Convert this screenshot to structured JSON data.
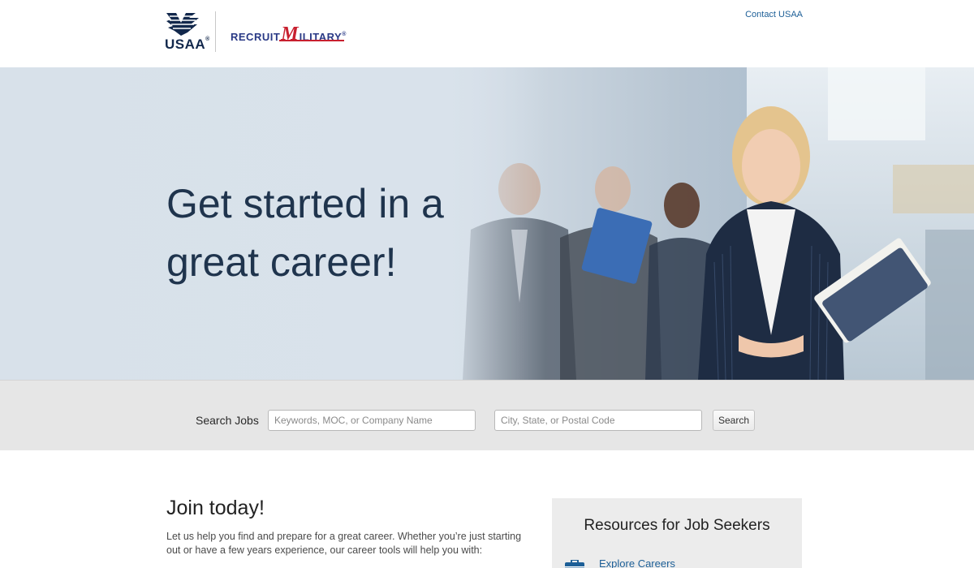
{
  "header": {
    "usaa_logo_text": "USAA",
    "usaa_reg": "®",
    "rm_logo_left": "RECRUIT",
    "rm_logo_m": "M",
    "rm_logo_right": "ILITARY",
    "rm_reg": "®",
    "contact_link": "Contact USAA"
  },
  "hero": {
    "title_line1": "Get started in a",
    "title_line2": "great career!"
  },
  "search": {
    "label": "Search Jobs",
    "keywords_placeholder": "Keywords, MOC, or Company Name",
    "location_placeholder": "City, State, or Postal Code",
    "button_label": "Search"
  },
  "content": {
    "join_title": "Join today!",
    "join_text": "Let us help you find and prepare for a great career. Whether you’re just starting out or have a few years experience, our career tools will help you with:",
    "resources_title": "Resources for Job Seekers",
    "resource_items": [
      {
        "label": "Explore Careers",
        "icon": "briefcase-icon"
      }
    ]
  },
  "colors": {
    "brand_navy": "#12284c",
    "link_blue": "#1d5f97",
    "rm_red": "#c8202f",
    "hero_text": "#1f344d"
  }
}
